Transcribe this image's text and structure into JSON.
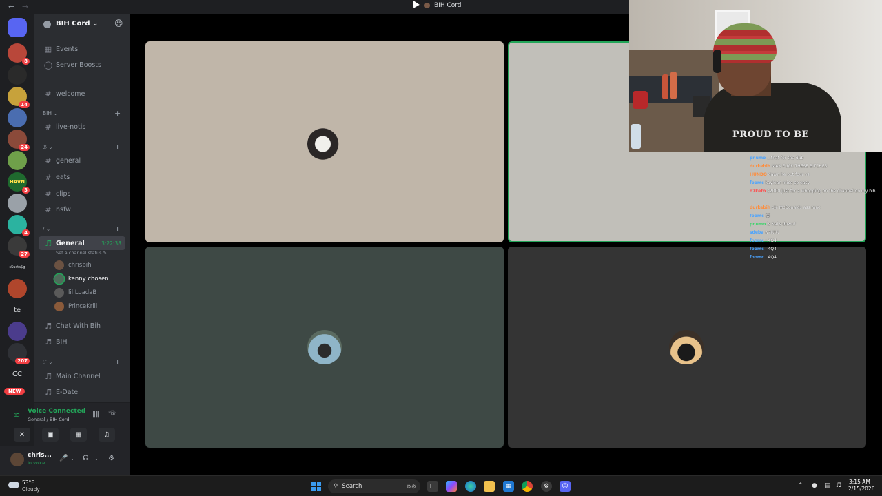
{
  "titlebar": {
    "back_icon": "arrow-left",
    "forward_icon": "arrow-right",
    "title": "BIH Cord"
  },
  "rail": {
    "servers": [
      {
        "name": "discord-home",
        "text": "",
        "badge": "",
        "color": "#5865f2"
      },
      {
        "name": "server-1",
        "text": "",
        "badge": "8",
        "color": "#b9473a"
      },
      {
        "name": "server-2",
        "text": "",
        "badge": "",
        "color": "#2a2a2a"
      },
      {
        "name": "server-3",
        "text": "",
        "badge": "14",
        "color": "#c7a23b"
      },
      {
        "name": "server-4",
        "text": "",
        "badge": "",
        "color": "#4a6db0"
      },
      {
        "name": "server-5",
        "text": "",
        "badge": "24",
        "color": "#8b4a3a"
      },
      {
        "name": "server-6",
        "text": "",
        "badge": "",
        "color": "#6fa04a"
      },
      {
        "name": "server-7",
        "text": "HAVN",
        "badge": "3",
        "color": "#1f6a2e"
      },
      {
        "name": "server-8",
        "text": "",
        "badge": "",
        "color": "#9aa1a8"
      },
      {
        "name": "server-9",
        "text": "",
        "badge": "4",
        "color": "#2bb3a0"
      },
      {
        "name": "server-10",
        "text": "",
        "badge": "27",
        "color": "#3a3a3a"
      },
      {
        "name": "server-11",
        "text": "sSusta$g",
        "badge": "",
        "color": "#1e1f22"
      },
      {
        "name": "server-12",
        "text": "",
        "badge": "",
        "color": "#b0462c"
      },
      {
        "name": "server-13",
        "text": "te",
        "badge": "",
        "color": "#1e1f22"
      },
      {
        "name": "server-14",
        "text": "",
        "badge": "",
        "color": "#4b3c8c"
      },
      {
        "name": "server-15",
        "text": "",
        "badge": "207",
        "color": "#2f3136"
      },
      {
        "name": "server-16",
        "text": "CC",
        "badge": "",
        "color": "#1e1f22"
      }
    ],
    "new_label": "NEW"
  },
  "sidebar": {
    "server_name": "BIH Cord",
    "top_items": [
      {
        "label": "Events",
        "icon": "calendar"
      },
      {
        "label": "Server Boosts",
        "icon": "boost"
      }
    ],
    "channels": {
      "welcome": "welcome",
      "cat_bih": "BIH ⌄",
      "live_notis": "live-notis",
      "cat_2": "ℬ ⌄",
      "general": "general",
      "eats": "eats",
      "clips": "clips",
      "nsfw": "nsfw",
      "cat_3": "/ ⌄",
      "voice_general": "General",
      "voice_timer": "3:22:38",
      "status_line": "Set a channel status ✎",
      "cat_4": "ℱ ⌄",
      "chat_with_bih": "Chat With Bih",
      "bih_voice": "BIH",
      "main_channel": "Main Channel",
      "e_date": "E-Date"
    },
    "voice_users": [
      {
        "name": "chrisbih",
        "color": "#6b5242"
      },
      {
        "name": "kenny chosen",
        "color": "#4e6b5a"
      },
      {
        "name": "lil LoadaB",
        "color": "#5a5a5a"
      },
      {
        "name": "PrinceKrill",
        "color": "#8a5a3a"
      }
    ]
  },
  "voice_panel": {
    "title": "Voice Connected",
    "subtitle": "General / BIH Cord",
    "buttons": [
      "camera-off-icon",
      "screen-share-icon",
      "activities-icon",
      "soundboard-icon"
    ]
  },
  "user_panel": {
    "name": "chris...",
    "status": "In voice"
  },
  "tiles": [
    {
      "name": "participant-1",
      "bg": "#c0b6a9"
    },
    {
      "name": "participant-2",
      "bg": "#c1bfb9"
    },
    {
      "name": "participant-3",
      "bg": "#3e4945"
    },
    {
      "name": "participant-4",
      "bg": "#343434"
    }
  ],
  "webcam": {
    "shirt_text": "PROUD TO BE"
  },
  "chat": [
    {
      "user": "pnumo",
      "text": "...that for the dub",
      "color": "#4aa3ff"
    },
    {
      "user": "durkebih",
      "text": "MAN FUCK THESE BITCHES",
      "color": "#ff8c3a"
    },
    {
      "user": "HUNDO",
      "text": "dawn he out four vs",
      "color": "#ff8c3a"
    },
    {
      "user": "foomc",
      "text": "kayleah mice so easy",
      "color": "#4aa3ff"
    },
    {
      "user": "o7keto",
      "text": "$2000 just for a whooping on the channel on my bih",
      "color": "#ff4a4a"
    },
    {
      "user": "durkebih",
      "text": "ole McDonalds ass mac",
      "color": "#ff8c3a"
    },
    {
      "user": "foomc",
      "text": "🐺",
      "color": "#4aa3ff"
    },
    {
      "user": "pnumo",
      "text": "is Kai's down?",
      "color": "#3ad46a"
    },
    {
      "user": "sdeba",
      "text": "wattttt",
      "color": "#4aa3ff"
    },
    {
      "user": "foomc",
      "text": ": 4Q4",
      "color": "#4aa3ff"
    },
    {
      "user": "foomc",
      "text": ": 4Q4",
      "color": "#4aa3ff"
    },
    {
      "user": "foomc",
      "text": ": 4Q4",
      "color": "#4aa3ff"
    }
  ],
  "taskbar": {
    "temperature": "53°F",
    "condition": "Cloudy",
    "search_placeholder": "Search",
    "apps": [
      "widgets-icon",
      "task-view-icon",
      "copilot-icon",
      "edge-icon",
      "file-explorer-icon",
      "store-icon",
      "chrome-icon",
      "app-icon",
      "discord-icon"
    ],
    "time": "3:15 AM",
    "date": "2/15/2026"
  }
}
